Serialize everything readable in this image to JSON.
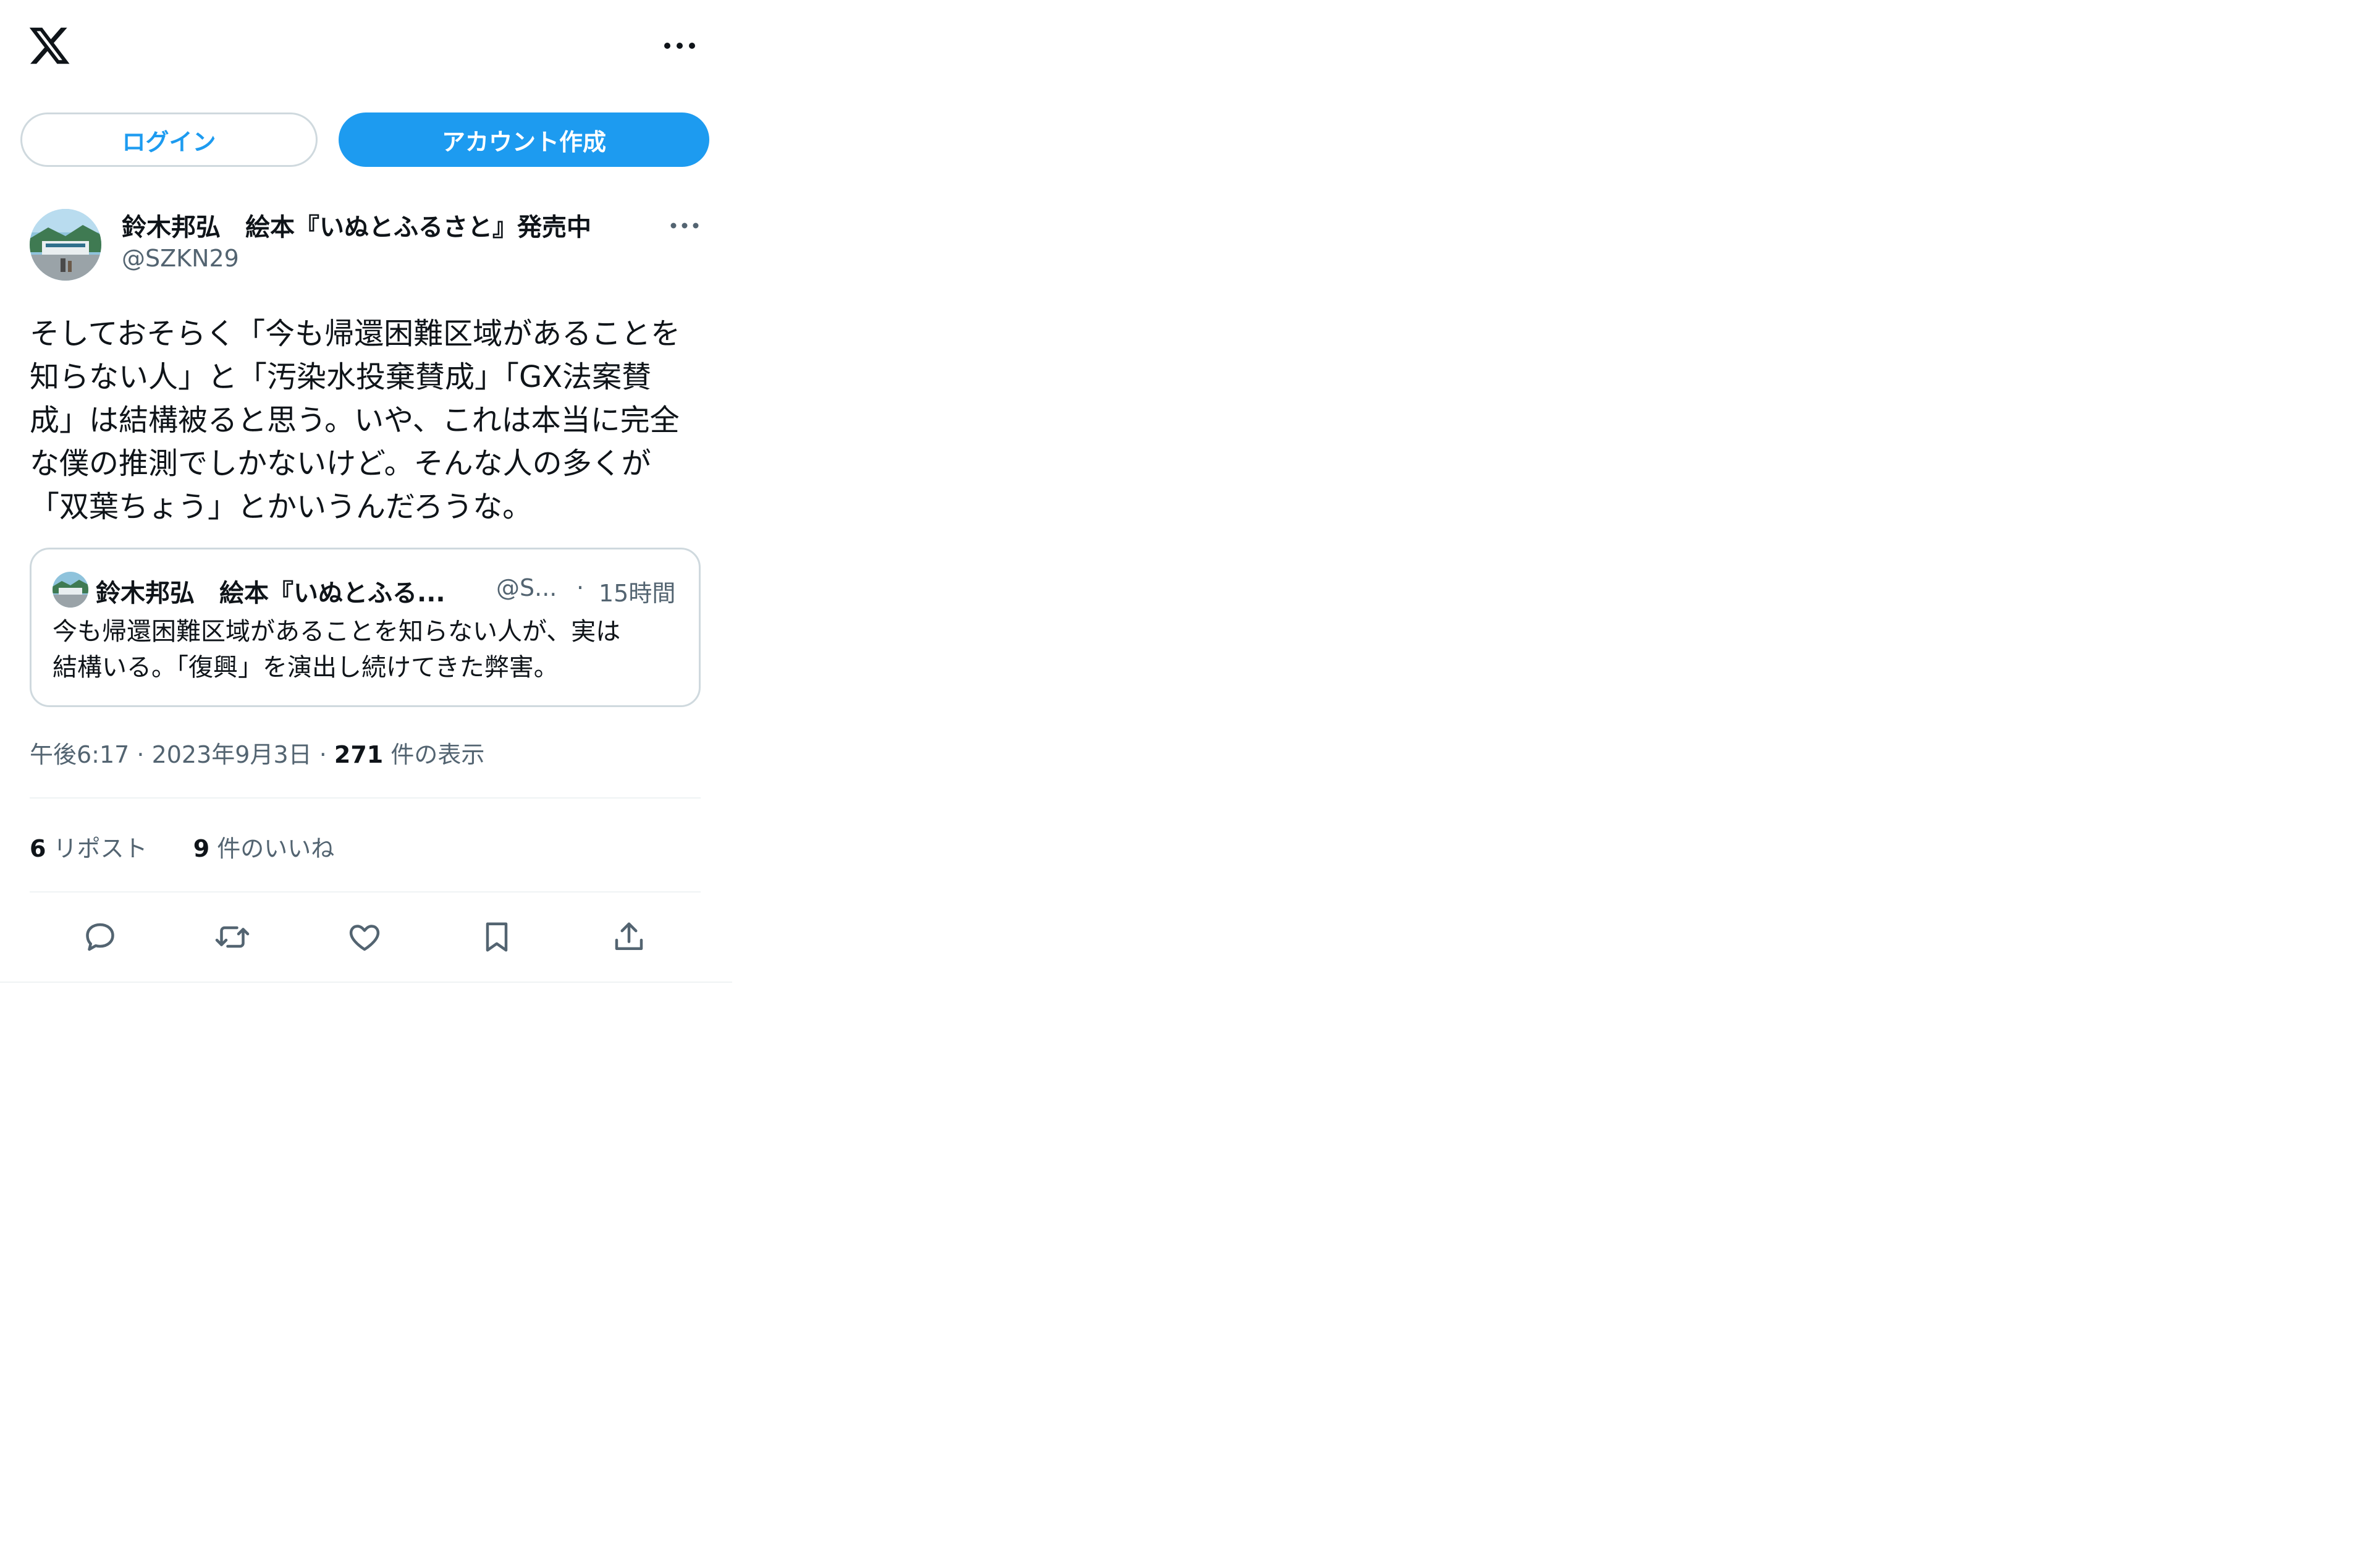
{
  "header": {
    "logo_icon": "x-logo-icon",
    "more_icon": "more-horizontal-icon"
  },
  "auth": {
    "login_label": "ログイン",
    "signup_label": "アカウント作成"
  },
  "post": {
    "author_name": "鈴木邦弘　絵本『いぬとふるさと』発売中",
    "handle": "@SZKN29",
    "body_lines": [
      "そしておそらく「今も帰還困難区域があることを",
      "知らない人」と「汚染水投棄賛成」「GX法案賛",
      "成」は結構被ると思う。いや、これは本当に完全",
      "な僕の推測でしかないけど。そんな人の多くが",
      "「双葉ちょう」とかいうんだろうな。"
    ],
    "quote": {
      "author_name": "鈴木邦弘　絵本『いぬとふる...",
      "handle": "@S...",
      "separator": "·",
      "time": "15時間",
      "text_lines": [
        "今も帰還困難区域があることを知らない人が、実は",
        "結構いる。「復興」を演出し続けてきた弊害。"
      ]
    },
    "timestamp": "午後6:17 · 2023年9月3日",
    "meta_separator": "·",
    "views_count": "271",
    "views_label": "件の表示",
    "reposts_count": "6",
    "reposts_label": "リポスト",
    "likes_count": "9",
    "likes_label": "件のいいね"
  },
  "actions": [
    "reply-icon",
    "repost-icon",
    "like-icon",
    "bookmark-icon",
    "share-icon"
  ],
  "colors": {
    "accent": "#1d9bf0",
    "text": "#0f1419",
    "secondary": "#536471",
    "border": "#cfd9de"
  }
}
